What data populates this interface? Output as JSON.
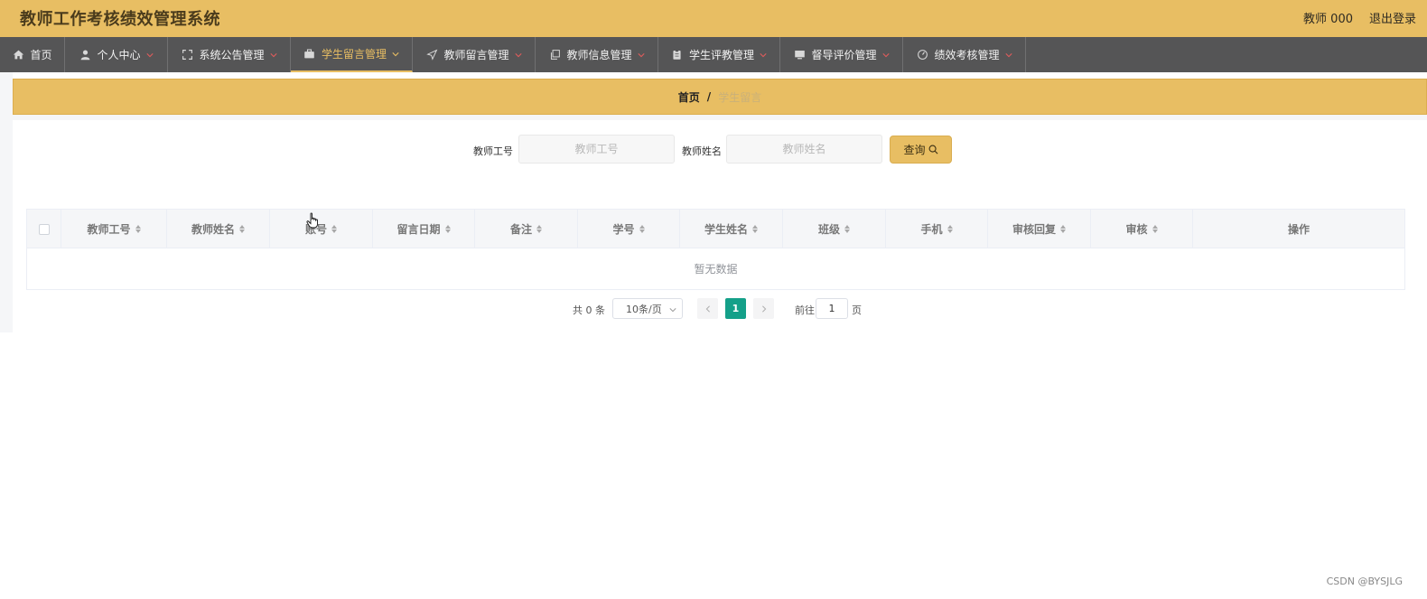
{
  "header": {
    "title": "教师工作考核绩效管理系统",
    "user": "教师 000",
    "logout": "退出登录"
  },
  "nav": {
    "items": [
      {
        "label": "首页",
        "icon": "home-icon"
      },
      {
        "label": "个人中心",
        "icon": "user-icon"
      },
      {
        "label": "系统公告管理",
        "icon": "expand-icon"
      },
      {
        "label": "学生留言管理",
        "icon": "briefcase-icon"
      },
      {
        "label": "教师留言管理",
        "icon": "send-icon"
      },
      {
        "label": "教师信息管理",
        "icon": "copy-icon"
      },
      {
        "label": "学生评教管理",
        "icon": "clipboard-icon"
      },
      {
        "label": "督导评价管理",
        "icon": "monitor-icon"
      },
      {
        "label": "绩效考核管理",
        "icon": "gauge-icon"
      }
    ],
    "active_label": "学生留言管理",
    "active_color": "#e8be63"
  },
  "breadcrumb": {
    "home": "首页",
    "separator": "/",
    "current": "学生留言"
  },
  "search": {
    "teacher_id_label": "教师工号",
    "teacher_id_placeholder": "教师工号",
    "teacher_id_value": "",
    "teacher_name_label": "教师姓名",
    "teacher_name_placeholder": "教师姓名",
    "teacher_name_value": "",
    "query_label": "查询"
  },
  "table": {
    "columns": [
      "教师工号",
      "教师姓名",
      "账号",
      "留言日期",
      "备注",
      "学号",
      "学生姓名",
      "班级",
      "手机",
      "审核回复",
      "审核",
      "操作"
    ],
    "empty_text": "暂无数据"
  },
  "pagination": {
    "total": "共 0 条",
    "page_size": "10条/页",
    "current_page": "1",
    "goto_label": "前往",
    "goto_value": "1",
    "page_unit": "页"
  },
  "watermark": "CSDN @BYSJLG",
  "colors": {
    "brand": "#e8be63",
    "nav_bg": "#555556",
    "pager_active": "#14a089"
  }
}
